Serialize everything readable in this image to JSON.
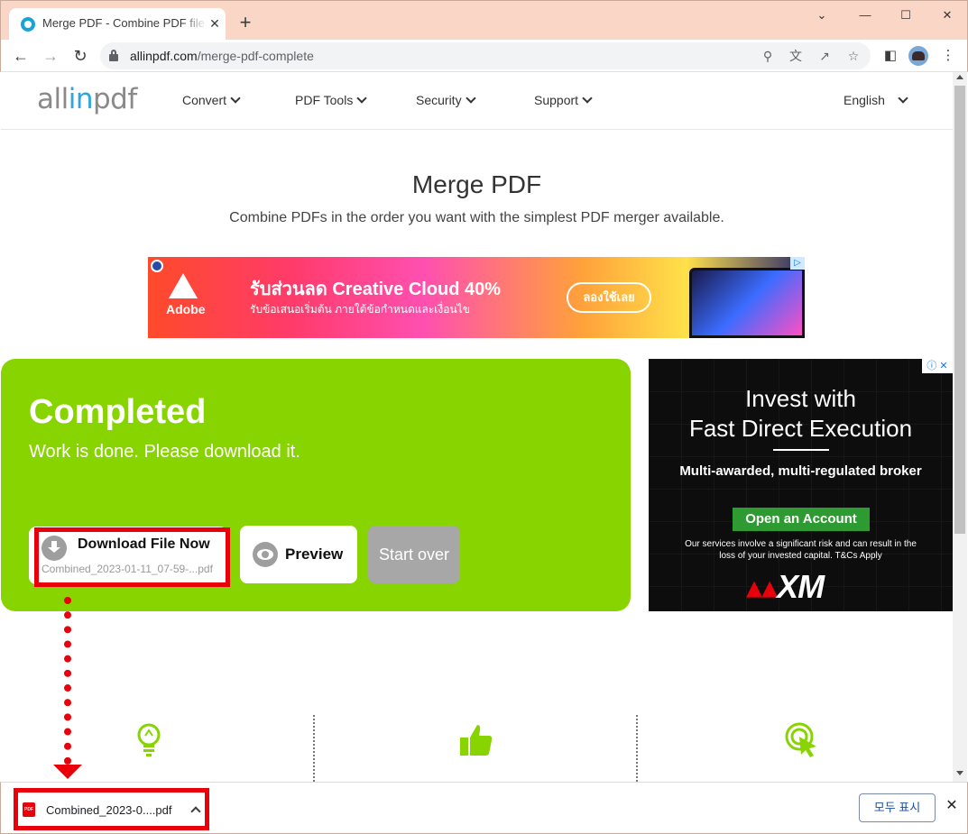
{
  "browser": {
    "tab_title": "Merge PDF - Combine PDF files",
    "tab_close": "✕",
    "new_tab": "+",
    "url_host": "allinpdf.com",
    "url_path": "/merge-pdf-complete"
  },
  "site": {
    "logo_all": "all",
    "logo_in": "in",
    "logo_pdf": "pdf",
    "nav": [
      {
        "label": "Convert"
      },
      {
        "label": "PDF Tools"
      },
      {
        "label": "Security"
      },
      {
        "label": "Support"
      }
    ],
    "language": "English"
  },
  "main": {
    "title": "Merge PDF",
    "subtitle": "Combine PDFs in the order you want with the simplest PDF merger available."
  },
  "banner_ad": {
    "brand": "Adobe",
    "headline": "รับส่วนลด Creative Cloud 40%",
    "text": "รับข้อเสนอเริ่มต้น ภายใต้ข้อกำหนดและเงื่อนไข",
    "cta": "ลองใช้เลย"
  },
  "completed": {
    "title": "Completed",
    "subtitle": "Work is done. Please download it.",
    "download_label": "Download File Now",
    "download_file": "Combined_2023-01-11_07-59-...pdf",
    "preview_label": "Preview",
    "start_over_label": "Start over"
  },
  "side_ad": {
    "title_line1": "Invest with",
    "title_line2": "Fast Direct Execution",
    "subtitle": "Multi-awarded, multi-regulated broker",
    "cta": "Open an Account",
    "risk": "Our services involve a significant risk and can result in the loss of your invested capital. T&Cs Apply",
    "logo": "XM"
  },
  "download_shelf": {
    "file_name": "Combined_2023-0....pdf",
    "show_all": "모두 표시",
    "close": "✕"
  },
  "colors": {
    "accent_green": "#88d400",
    "highlight_red": "#e8000b",
    "logo_blue": "#2aa7e0"
  },
  "icons": [
    "lightbulb-icon",
    "thumbs-up-icon",
    "cursor-click-icon"
  ]
}
